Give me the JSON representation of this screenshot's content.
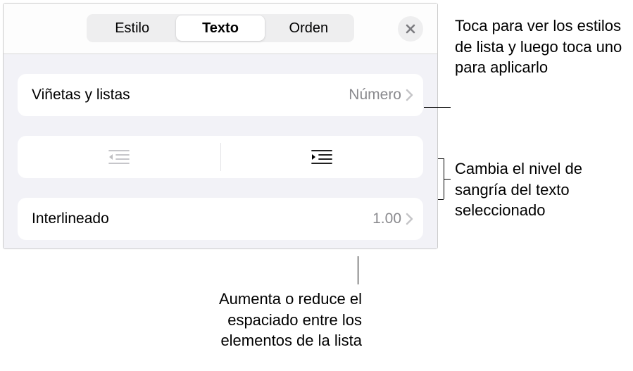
{
  "header": {
    "tabs": [
      "Estilo",
      "Texto",
      "Orden"
    ],
    "activeTab": 1
  },
  "rows": {
    "bullets": {
      "label": "Viñetas y listas",
      "value": "Número"
    },
    "lineSpacing": {
      "label": "Interlineado",
      "value": "1.00"
    }
  },
  "annotations": {
    "a1": "Toca para ver los estilos de lista y luego toca uno para aplicarlo",
    "a2": "Cambia el nivel de sangría del texto seleccionado",
    "a3": "Aumenta o reduce el espaciado entre los elementos de la lista"
  }
}
